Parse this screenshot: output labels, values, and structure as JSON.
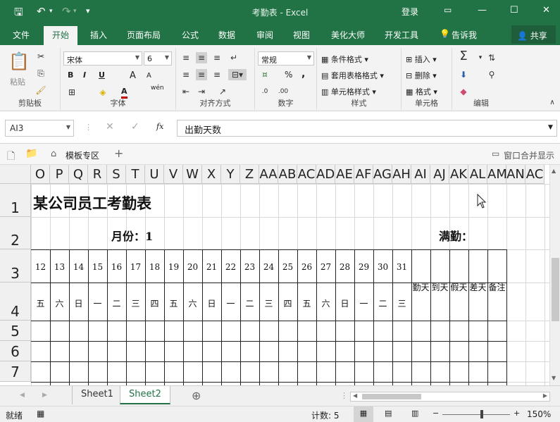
{
  "window": {
    "title": "考勤表 - Excel",
    "login": "登录",
    "undo_icon": "undo-icon",
    "redo_icon": "redo-icon"
  },
  "tabs": [
    {
      "label": "文件"
    },
    {
      "label": "开始"
    },
    {
      "label": "插入"
    },
    {
      "label": "页面布局"
    },
    {
      "label": "公式"
    },
    {
      "label": "数据"
    },
    {
      "label": "审阅"
    },
    {
      "label": "视图"
    },
    {
      "label": "美化大师"
    },
    {
      "label": "开发工具"
    }
  ],
  "tell_me": "告诉我",
  "share": "共享",
  "ribbon": {
    "clipboard": {
      "paste": "粘贴",
      "label": "剪贴板"
    },
    "font": {
      "name": "宋体",
      "size": "6",
      "bold": "B",
      "italic": "I",
      "underline": "U",
      "grow": "A",
      "shrink": "A",
      "label": "字体",
      "phonetic": "wén"
    },
    "alignment": {
      "label": "对齐方式"
    },
    "number": {
      "format": "常规",
      "percent": "%",
      "comma": ",",
      "label": "数字"
    },
    "styles": {
      "conditional": "条件格式",
      "table": "套用表格格式",
      "cell": "单元格样式",
      "label": "样式"
    },
    "cells": {
      "insert": "插入",
      "delete": "删除",
      "format": "格式",
      "label": "单元格"
    },
    "editing": {
      "label": "编辑"
    }
  },
  "formula": {
    "name_box": "AI3",
    "fx": "fx",
    "value": "出勤天数"
  },
  "template_bar": {
    "template": "模板专区",
    "window_merge": "窗口合并显示"
  },
  "columns": [
    "O",
    "P",
    "Q",
    "R",
    "S",
    "T",
    "U",
    "V",
    "W",
    "X",
    "Y",
    "Z",
    "AA",
    "AB",
    "AC",
    "AD",
    "AE",
    "AF",
    "AG",
    "AH",
    "AI",
    "AJ",
    "AK",
    "AL",
    "AM",
    "AN",
    "AC"
  ],
  "rows": [
    "1",
    "2",
    "3",
    "4",
    "5",
    "6",
    "7"
  ],
  "sheet": {
    "title": "某公司员工考勤表",
    "month": "月份：1",
    "full_attendance": "满勤：",
    "days": [
      "12",
      "13",
      "14",
      "15",
      "16",
      "17",
      "18",
      "19",
      "20",
      "21",
      "22",
      "23",
      "24",
      "25",
      "26",
      "27",
      "28",
      "29",
      "30",
      "31"
    ],
    "weekdays": [
      "五",
      "六",
      "日",
      "一",
      "二",
      "三",
      "四",
      "五",
      "六",
      "日",
      "一",
      "二",
      "三",
      "四",
      "五",
      "六",
      "日",
      "一",
      "二",
      "三"
    ],
    "summary_cols": [
      "勤天",
      "到天",
      "假天",
      "差天",
      "备注"
    ]
  },
  "sheet_tabs": [
    "Sheet1",
    "Sheet2"
  ],
  "status": {
    "ready": "就绪",
    "count": "计数: 5",
    "zoom": "150%"
  }
}
